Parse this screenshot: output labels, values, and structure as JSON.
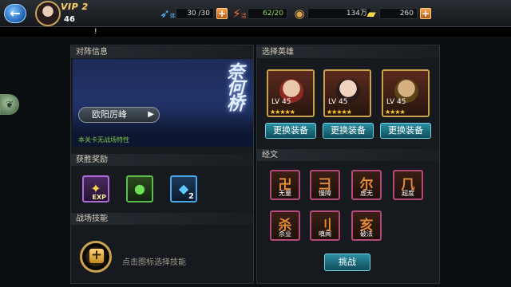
{
  "player": {
    "vip": "VIP 2",
    "level": "46"
  },
  "resources": {
    "stamina": {
      "icon_label": "体",
      "value": "30 /30",
      "icon": "feather-icon"
    },
    "vitality": {
      "icon_label": "活",
      "value": "62/20",
      "icon": "lightning-icon"
    },
    "coins": {
      "value": "134万",
      "icon": "coin-icon"
    },
    "gold": {
      "value": "260",
      "icon": "gold-ingot-icon"
    }
  },
  "notice": "!",
  "battle_info": {
    "header": "对阵信息",
    "banner_title": "奈何桥",
    "enemy_name": "欧阳厉峰",
    "field_trait": "本关卡无战场特性"
  },
  "rewards": {
    "header": "获胜奖励",
    "items": [
      {
        "icon": "exp-scroll-icon",
        "label": "EXP",
        "count": ""
      },
      {
        "icon": "green-orb-icon",
        "label": "",
        "count": ""
      },
      {
        "icon": "blue-gem-icon",
        "label": "",
        "count": "2"
      }
    ]
  },
  "battle_skill": {
    "header": "战场技能",
    "hint": "点击图标选择技能"
  },
  "select_hero": {
    "header": "选择英雄",
    "heroes": [
      {
        "level": "LV 45",
        "stars": "★★★★★",
        "color": "#b8433a"
      },
      {
        "level": "LV 45",
        "stars": "★★★★★",
        "color": "#e1c1a3"
      },
      {
        "level": "LV 45",
        "stars": "★★★★",
        "color": "#c59a44"
      }
    ],
    "equip_label": "更换装备"
  },
  "scriptures": {
    "header": "经文",
    "items": [
      {
        "label": "无量",
        "glyph": "卍"
      },
      {
        "label": "慢障",
        "glyph": "彐"
      },
      {
        "label": "虚无",
        "glyph": "尔"
      },
      {
        "label": "超度",
        "glyph": "⺇"
      },
      {
        "label": "杀业",
        "glyph": "杀"
      },
      {
        "label": "嗔闻",
        "glyph": "刂"
      },
      {
        "label": "破法",
        "glyph": "亥"
      }
    ]
  },
  "challenge_label": "挑战"
}
